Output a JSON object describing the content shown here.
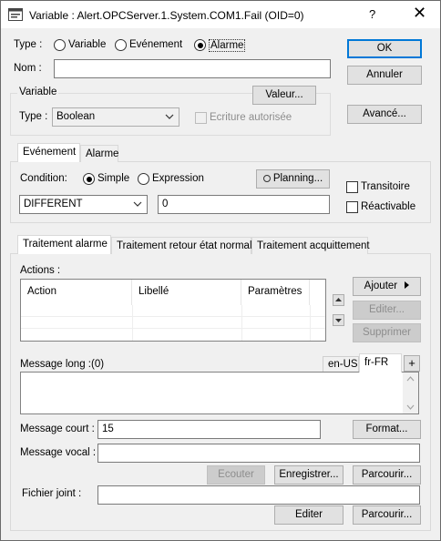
{
  "window": {
    "title": "Variable : Alert.OPCServer.1.System.COM1.Fail (OID=0)",
    "help": "?",
    "close": "✕"
  },
  "type_row": {
    "label": "Type :",
    "options": [
      "Variable",
      "Evénement",
      "Alarme"
    ],
    "selected": "Alarme"
  },
  "nom": {
    "label": "Nom :",
    "value": ""
  },
  "variable_group": {
    "title": "Variable",
    "valeur_button": "Valeur...",
    "type_label": "Type :",
    "type_value": "Boolean",
    "ecriture_label": "Ecriture autorisée"
  },
  "side_buttons": {
    "ok": "OK",
    "annuler": "Annuler",
    "avance": "Avancé..."
  },
  "top_tabs": [
    "Evénement",
    "Alarme"
  ],
  "evenement": {
    "condition_label": "Condition:",
    "simple": "Simple",
    "expression": "Expression",
    "planning": "Planning...",
    "transitoire": "Transitoire",
    "reactivable": "Réactivable",
    "operator": "DIFFERENT",
    "operand": "0"
  },
  "bottom_tabs": [
    "Traitement alarme",
    "Traitement retour état normal",
    "Traitement acquittement"
  ],
  "actions": {
    "label": "Actions :",
    "columns": [
      "Action",
      "Libellé",
      "Paramètres"
    ],
    "ajouter": "Ajouter",
    "editer": "Editer...",
    "supprimer": "Supprimer"
  },
  "message_long": {
    "label": "Message long :",
    "count": "(0)",
    "lang_tabs": [
      "en-US",
      "fr-FR"
    ],
    "add": "+"
  },
  "message_court": {
    "label": "Message court :",
    "value": "15",
    "format": "Format..."
  },
  "message_vocal": {
    "label": "Message vocal :",
    "value": "",
    "ecouter": "Ecouter",
    "enregistrer": "Enregistrer...",
    "parcourir": "Parcourir..."
  },
  "fichier_joint": {
    "label": "Fichier joint :",
    "value": "",
    "editer": "Editer",
    "parcourir": "Parcourir..."
  }
}
